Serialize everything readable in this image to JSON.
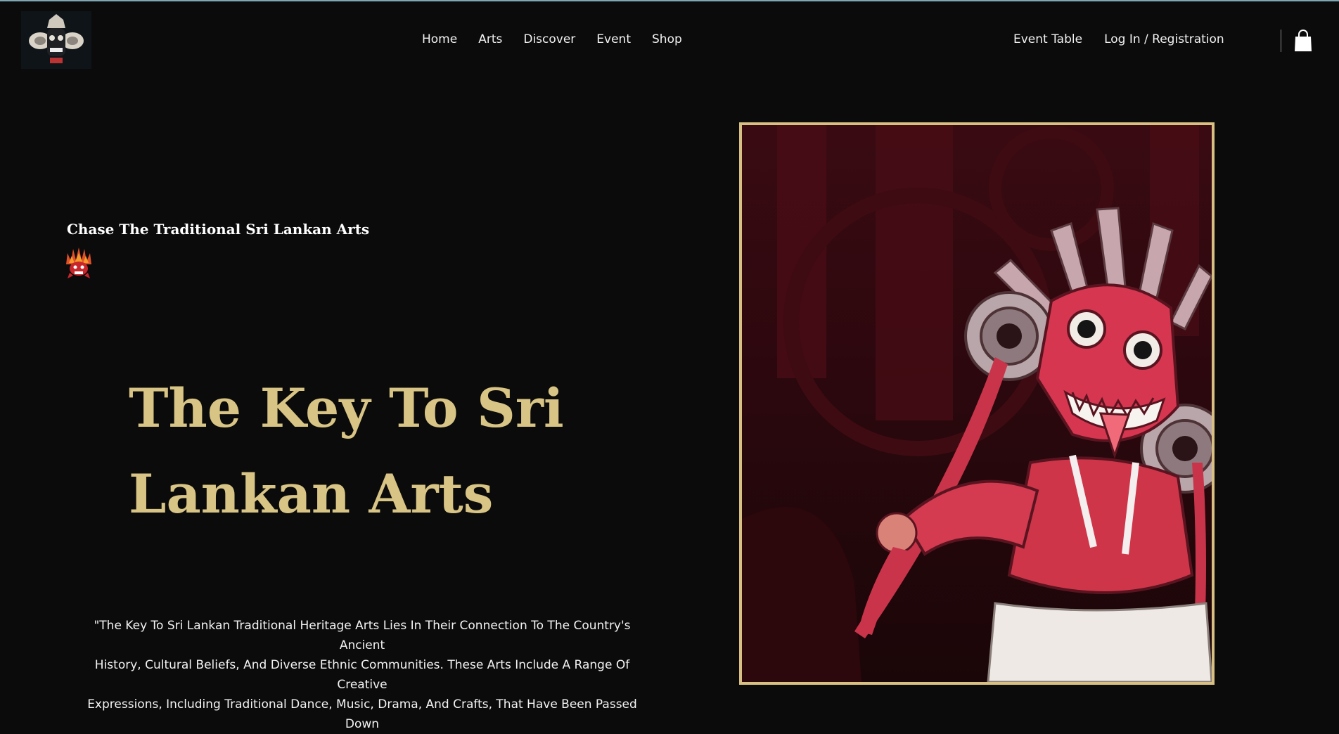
{
  "header": {
    "logo_icon": "devil-mask-logo-icon",
    "nav": [
      "Home",
      "Arts",
      "Discover",
      "Event",
      "Shop"
    ],
    "right_nav": [
      "Event Table",
      "Log In / Registration"
    ],
    "cart_icon": "shopping-bag-icon"
  },
  "hero": {
    "tagline": "Chase The Traditional Sri Lankan Arts",
    "tagline_icon": "mask-icon",
    "title_line1": "The Key To Sri",
    "title_line2": "Lankan Arts",
    "quote_l1": "\"The Key To Sri Lankan Traditional Heritage Arts Lies In Their Connection To The Country's Ancient",
    "quote_l2": "History, Cultural Beliefs, And Diverse Ethnic Communities. These Arts Include A Range Of Creative",
    "quote_l3": "Expressions, Including Traditional Dance, Music, Drama, And Crafts, That Have Been Passed Down"
  },
  "colors": {
    "background": "#0b0b0c",
    "gold": "#d8c484",
    "frame": "#d7c081",
    "mask_red": "#d6364f"
  },
  "image": {
    "subject_icon": "kolam-mask-dancer-illustration"
  }
}
